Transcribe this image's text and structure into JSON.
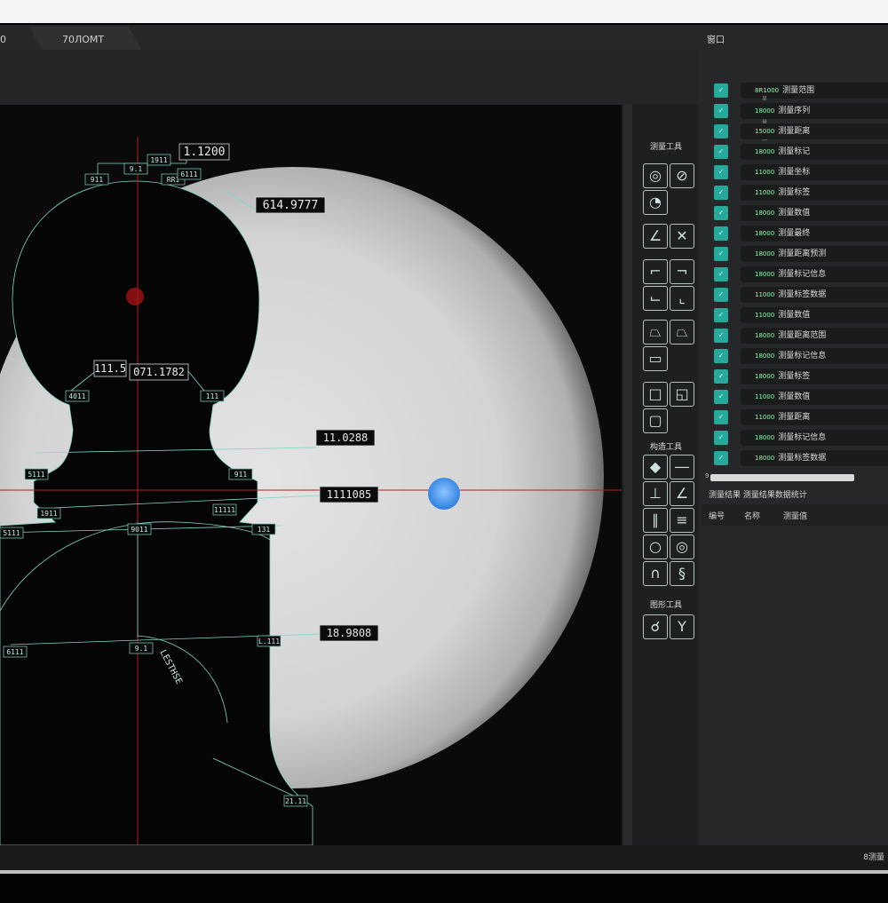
{
  "tabs": [
    "0",
    "70ЛОМТ"
  ],
  "panel_title": "窗口",
  "tool_groups": [
    "测量工具",
    "构造工具",
    "图形工具"
  ],
  "measurements": {
    "m1": "1.1200",
    "m2": "614.9777",
    "m3": "111.5",
    "m4": "071.1782",
    "m5": "11.0288",
    "m6": "1111085",
    "m7": "18.9808",
    "small_labels": [
      "911",
      "9.1",
      "RR1",
      "4011",
      "111",
      "5111",
      "911",
      "1911",
      "11111",
      "5111",
      "9011",
      "131",
      "6111",
      "L.111",
      "9.1",
      "21.11",
      "6111",
      "1911"
    ],
    "arc_label": "LESTHSE"
  },
  "list_items": [
    {
      "code": "8R1000",
      "label": "测量范围",
      "sub": "显示测量范围"
    },
    {
      "code": "18000",
      "label": "测量序列"
    },
    {
      "code": "15000",
      "label": "测量距离"
    },
    {
      "code": "18000",
      "label": "测量标记"
    },
    {
      "code": "11000",
      "label": "测量坐标"
    },
    {
      "code": "11000",
      "label": "测量标签"
    },
    {
      "code": "18000",
      "label": "测量数值"
    },
    {
      "code": "18000",
      "label": "测量最终"
    },
    {
      "code": "18000",
      "label": "测量距离预测"
    },
    {
      "code": "18000",
      "label": "测量标记信息"
    },
    {
      "code": "11000",
      "label": "测量标签数据"
    },
    {
      "code": "11000",
      "label": "测量数值"
    },
    {
      "code": "18000",
      "label": "测量距离范围"
    },
    {
      "code": "18000",
      "label": "测量标记信息"
    },
    {
      "code": "18000",
      "label": "测量标签"
    },
    {
      "code": "11000",
      "label": "测量数值"
    },
    {
      "code": "11000",
      "label": "测量距离"
    },
    {
      "code": "18000",
      "label": "测量标记信息"
    },
    {
      "code": "18000",
      "label": "测量标签数据"
    }
  ],
  "scroll_marker": "9",
  "section_head": "测量结果  测量结果数据统计",
  "section_row": [
    "编号",
    "名称",
    "测量值"
  ],
  "status": "8测量"
}
